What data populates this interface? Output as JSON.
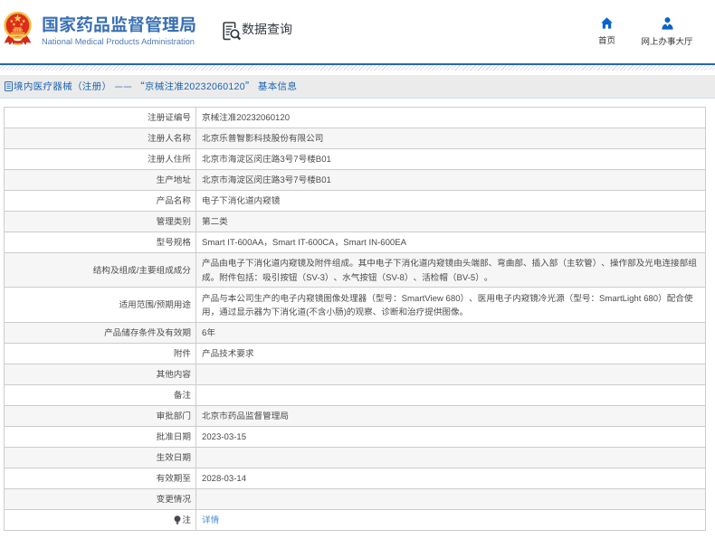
{
  "header": {
    "brand_title": "国家药品监督管理局",
    "brand_subtitle": "National Medical Products Administration",
    "section_label": "数据查询",
    "nav_home": "首页",
    "nav_hall": "网上办事大厅"
  },
  "breadcrumb": {
    "text": "境内医疗器械（注册） —— “京械注准20232060120” 基本信息"
  },
  "table": {
    "rows": [
      {
        "label": "注册证编号",
        "value": "京械注准20232060120"
      },
      {
        "label": "注册人名称",
        "value": "北京乐普智影科技股份有限公司"
      },
      {
        "label": "注册人住所",
        "value": "北京市海淀区闵庄路3号7号楼B01"
      },
      {
        "label": "生产地址",
        "value": "北京市海淀区闵庄路3号7号楼B01"
      },
      {
        "label": "产品名称",
        "value": "电子下消化道内窥镜"
      },
      {
        "label": "管理类别",
        "value": "第二类"
      },
      {
        "label": "型号规格",
        "value": "Smart IT-600AA，Smart IT-600CA，Smart IN-600EA"
      },
      {
        "label": "结构及组成/主要组成成分",
        "value": "产品由电子下消化道内窥镜及附件组成。其中电子下消化道内窥镜由头端部、弯曲部、插入部（主软管）、操作部及光电连接部组成。附件包括：吸引按钮（SV-3）、水气按钮（SV-8）、活检帽（BV-5）。"
      },
      {
        "label": "适用范围/预期用途",
        "value": "产品与本公司生产的电子内窥镜图像处理器（型号：SmartView 680）、医用电子内窥镜冷光源（型号：SmartLight 680）配合使用，通过显示器为下消化道(不含小肠)的观察、诊断和治疗提供图像。"
      },
      {
        "label": "产品储存条件及有效期",
        "value": "6年"
      },
      {
        "label": "附件",
        "value": "产品技术要求"
      },
      {
        "label": "其他内容",
        "value": ""
      },
      {
        "label": "备注",
        "value": ""
      },
      {
        "label": "审批部门",
        "value": "北京市药品监督管理局"
      },
      {
        "label": "批准日期",
        "value": "2023-03-15"
      },
      {
        "label": "生效日期",
        "value": ""
      },
      {
        "label": "有效期至",
        "value": "2028-03-14"
      },
      {
        "label": "变更情况",
        "value": ""
      },
      {
        "label": "注",
        "value": "详情"
      }
    ]
  },
  "colors": {
    "brand_blue": "#3a70b4",
    "divider_blue": "#2667b2",
    "crumb_bg": "#ebebeb",
    "crumb_text": "#1c64b1",
    "nav_icon_blue": "#0a63c9",
    "table_border": "#cccccc",
    "row_alt_bg": "#f6f6f6",
    "link_blue": "#4a90d9"
  }
}
